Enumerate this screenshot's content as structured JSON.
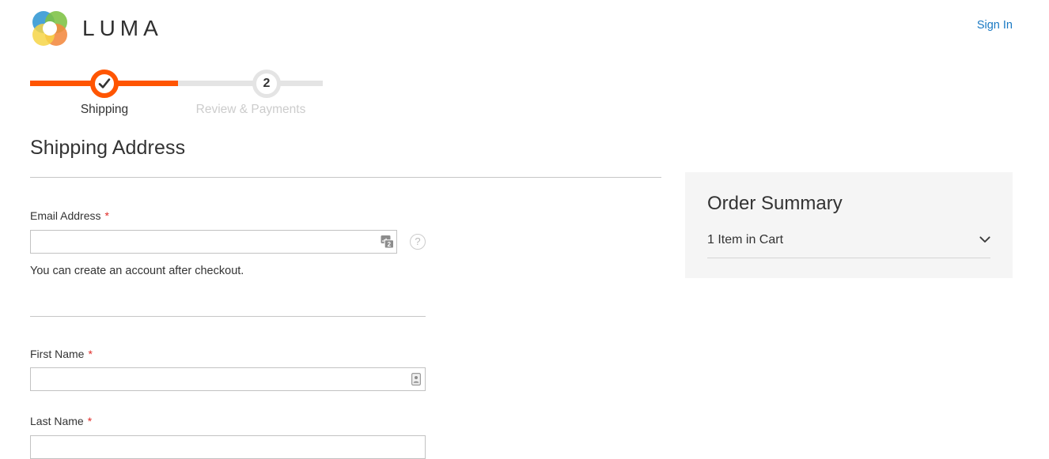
{
  "header": {
    "brand_name": "LUMA",
    "logo_colors": {
      "blue": "#49a3d8",
      "green": "#7dc243",
      "orange": "#f2893f",
      "yellow": "#f6d547"
    },
    "sign_in_label": "Sign In",
    "link_color": "#1979c3"
  },
  "progress": {
    "accent_color": "#ff5501",
    "inactive_color": "#e4e4e4",
    "steps": [
      {
        "label": "Shipping",
        "state": "complete",
        "marker": "check-icon"
      },
      {
        "label": "Review & Payments",
        "state": "upcoming",
        "marker": "2"
      }
    ]
  },
  "shipping": {
    "title": "Shipping Address",
    "email": {
      "label": "Email Address",
      "required_marker": "*",
      "value": "",
      "placeholder": "",
      "hint": "You can create an account after checkout.",
      "inline_icon": "autofill-badge-icon",
      "help_icon": "question-mark-icon"
    },
    "first_name": {
      "label": "First Name",
      "required_marker": "*",
      "value": "",
      "placeholder": "",
      "inline_icon": "contact-card-icon"
    },
    "last_name": {
      "label": "Last Name",
      "required_marker": "*",
      "value": "",
      "placeholder": ""
    }
  },
  "order_summary": {
    "title": "Order Summary",
    "cart_toggle_label": "1 Item in Cart",
    "toggle_icon": "chevron-down-icon",
    "panel_color": "#f5f5f5"
  }
}
